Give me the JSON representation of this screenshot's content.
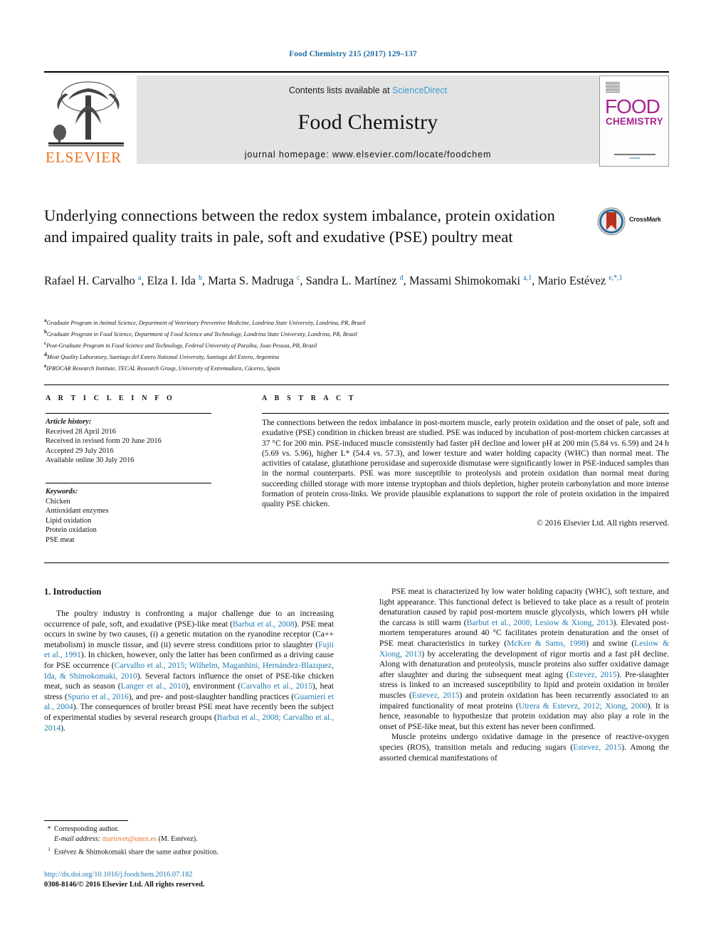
{
  "running_head": "Food Chemistry 215 (2017) 129–137",
  "masthead": {
    "contents_prefix": "Contents lists available at ",
    "sciencedirect": "ScienceDirect",
    "journal_title": "Food Chemistry",
    "homepage": "journal homepage: www.elsevier.com/locate/foodchem",
    "publisher_logo_text": "ELSEVIER",
    "cover": {
      "line1": "FOOD",
      "line2": "CHEMISTRY",
      "footer": "ELSEVIER"
    },
    "accent_color": "#3b9bd4",
    "cover_color": "#a8248e",
    "elsevier_color": "#e9711c"
  },
  "article": {
    "title": "Underlying connections between the redox system imbalance, protein oxidation and impaired quality traits in pale, soft and exudative (PSE) poultry meat",
    "crossmark_label": "CrossMark",
    "authors_html": "Rafael H. Carvalho <sup>a</sup>, Elza I. Ida <sup>b</sup>, Marta S. Madruga <sup>c</sup>, Sandra L. Martínez <sup>d</sup>, Massami Shimokomaki <sup>a,1</sup>, Mario Estévez <sup>e,*,1</sup>",
    "affiliations": [
      {
        "mark": "a",
        "text": "Graduate Program in Animal Science, Department of Veterinary Preventive Medicine, Londrina State University, Londrina, PR, Brazil"
      },
      {
        "mark": "b",
        "text": "Graduate Program in Food Science, Department of Food Science and Technology, Londrina State University, Londrina, PR, Brazil"
      },
      {
        "mark": "c",
        "text": "Post-Graduate Program in Food Science and Technology, Federal University of Paraiba, Joao Pessoa, PB, Brazil"
      },
      {
        "mark": "d",
        "text": "Meat Quality Laboratory, Santiago del Estero National University, Santiago del Estero, Argentina"
      },
      {
        "mark": "e",
        "text": "IPROCAR Research Institute, TECAL Research Group, University of Extremadura, Cáceres, Spain"
      }
    ]
  },
  "article_info": {
    "heading": "A R T I C L E   I N F O",
    "history_label": "Article history:",
    "history": [
      "Received 28 April 2016",
      "Received in revised form 20 June 2016",
      "Accepted 29 July 2016",
      "Available online 30 July 2016"
    ],
    "keywords_label": "Keywords:",
    "keywords": [
      "Chicken",
      "Antioxidant enzymes",
      "Lipid oxidation",
      "Protein oxidation",
      "PSE meat"
    ]
  },
  "abstract": {
    "heading": "A B S T R A C T",
    "text": "The connections between the redox imbalance in post-mortem muscle, early protein oxidation and the onset of pale, soft and exudative (PSE) condition in chicken breast are studied. PSE was induced by incubation of post-mortem chicken carcasses at 37 °C for 200 min. PSE-induced muscle consistently had faster pH decline and lower pH at 200 min (5.84 vs. 6.59) and 24 h (5.69 vs. 5.96), higher L* (54.4 vs. 57.3), and lower texture and water holding capacity (WHC) than normal meat. The activities of catalase, glutathione peroxidase and superoxide dismutase were significantly lower in PSE-induced samples than in the normal counterparts. PSE was more susceptible to proteolysis and protein oxidation than normal meat during succeeding chilled storage with more intense tryptophan and thiols depletion, higher protein carbonylation and more intense formation of protein cross-links. We provide plausible explanations to support the role of protein oxidation in the impaired quality PSE chicken.",
    "copyright": "© 2016 Elsevier Ltd. All rights reserved."
  },
  "body": {
    "section_heading": "1. Introduction",
    "left_paragraphs": [
      "The poultry industry is confronting a major challenge due to an increasing occurrence of pale, soft, and exudative (PSE)-like meat (#Barbut et al., 2008#). PSE meat occurs in swine by two causes, (i) a genetic mutation on the ryanodine receptor (Ca++ metabolism) in muscle tissue, and (ii) severe stress conditions prior to slaughter (#Fujii et al., 1991#). In chicken, however, only the latter has been confirmed as a driving cause for PSE occurrence (#Carvalho et al., 2015; Wilhelm, Maganhini, Hernández-Blazquez, Ida, & Shimokomaki, 2010#). Several factors influence the onset of PSE-like chicken meat, such as season (#Langer et al., 2010#), environment (#Carvalho et al., 2015#), heat stress (#Spurio et al., 2016#), and pre- and post-slaughter handling practices (#Guarnieri et al., 2004#). The consequences of broiler breast PSE meat have recently been the subject of experimental studies by several research groups (#Barbut et al., 2008; Carvalho et al., 2014#)."
    ],
    "right_paragraphs": [
      "PSE meat is characterized by low water holding capacity (WHC), soft texture, and light appearance. This functional defect is believed to take place as a result of protein denaturation caused by rapid post-mortem muscle glycolysis, which lowers pH while the carcass is still warm (#Barbut et al., 2008; Lesiow & Xiong, 2013#). Elevated post-mortem temperatures around 40 °C facilitates protein denaturation and the onset of PSE meat characteristics in turkey (#McKee & Sams, 1998#) and swine (#Lesiow & Xiong, 2013#) by accelerating the development of rigor mortis and a fast pH decline. Along with denaturation and proteolysis, muscle proteins also suffer oxidative damage after slaughter and during the subsequent meat aging (#Estevez, 2015#). Pre-slaughter stress is linked to an increased susceptibility to lipid and protein oxidation in broiler muscles (#Estevez, 2015#) and protein oxidation has been recurrently associated to an impaired functionality of meat proteins (#Utrera & Estevez, 2012; Xiong, 2000#). It is hence, reasonable to hypothesize that protein oxidation may also play a role in the onset of PSE-like meat, but this extent has never been confirmed.",
      "Muscle proteins undergo oxidative damage in the presence of reactive-oxygen species (ROS), transition metals and reducing sugars (#Estevez, 2015#). Among the assorted chemical manifestations of"
    ],
    "citation_color": "#1f7ab0"
  },
  "footnotes": {
    "corresponding_mark": "*",
    "corresponding_text": "Corresponding author.",
    "email_label": "E-mail address:",
    "email": "mariovet@unex.es",
    "email_suffix": "(M. Estévez).",
    "note_mark": "1",
    "note_text": "Estévez & Shimokomaki share the same author position.",
    "doi": "http://dx.doi.org/10.1016/j.foodchem.2016.07.182",
    "issn_line": "0308-8146/© 2016 Elsevier Ltd. All rights reserved."
  }
}
